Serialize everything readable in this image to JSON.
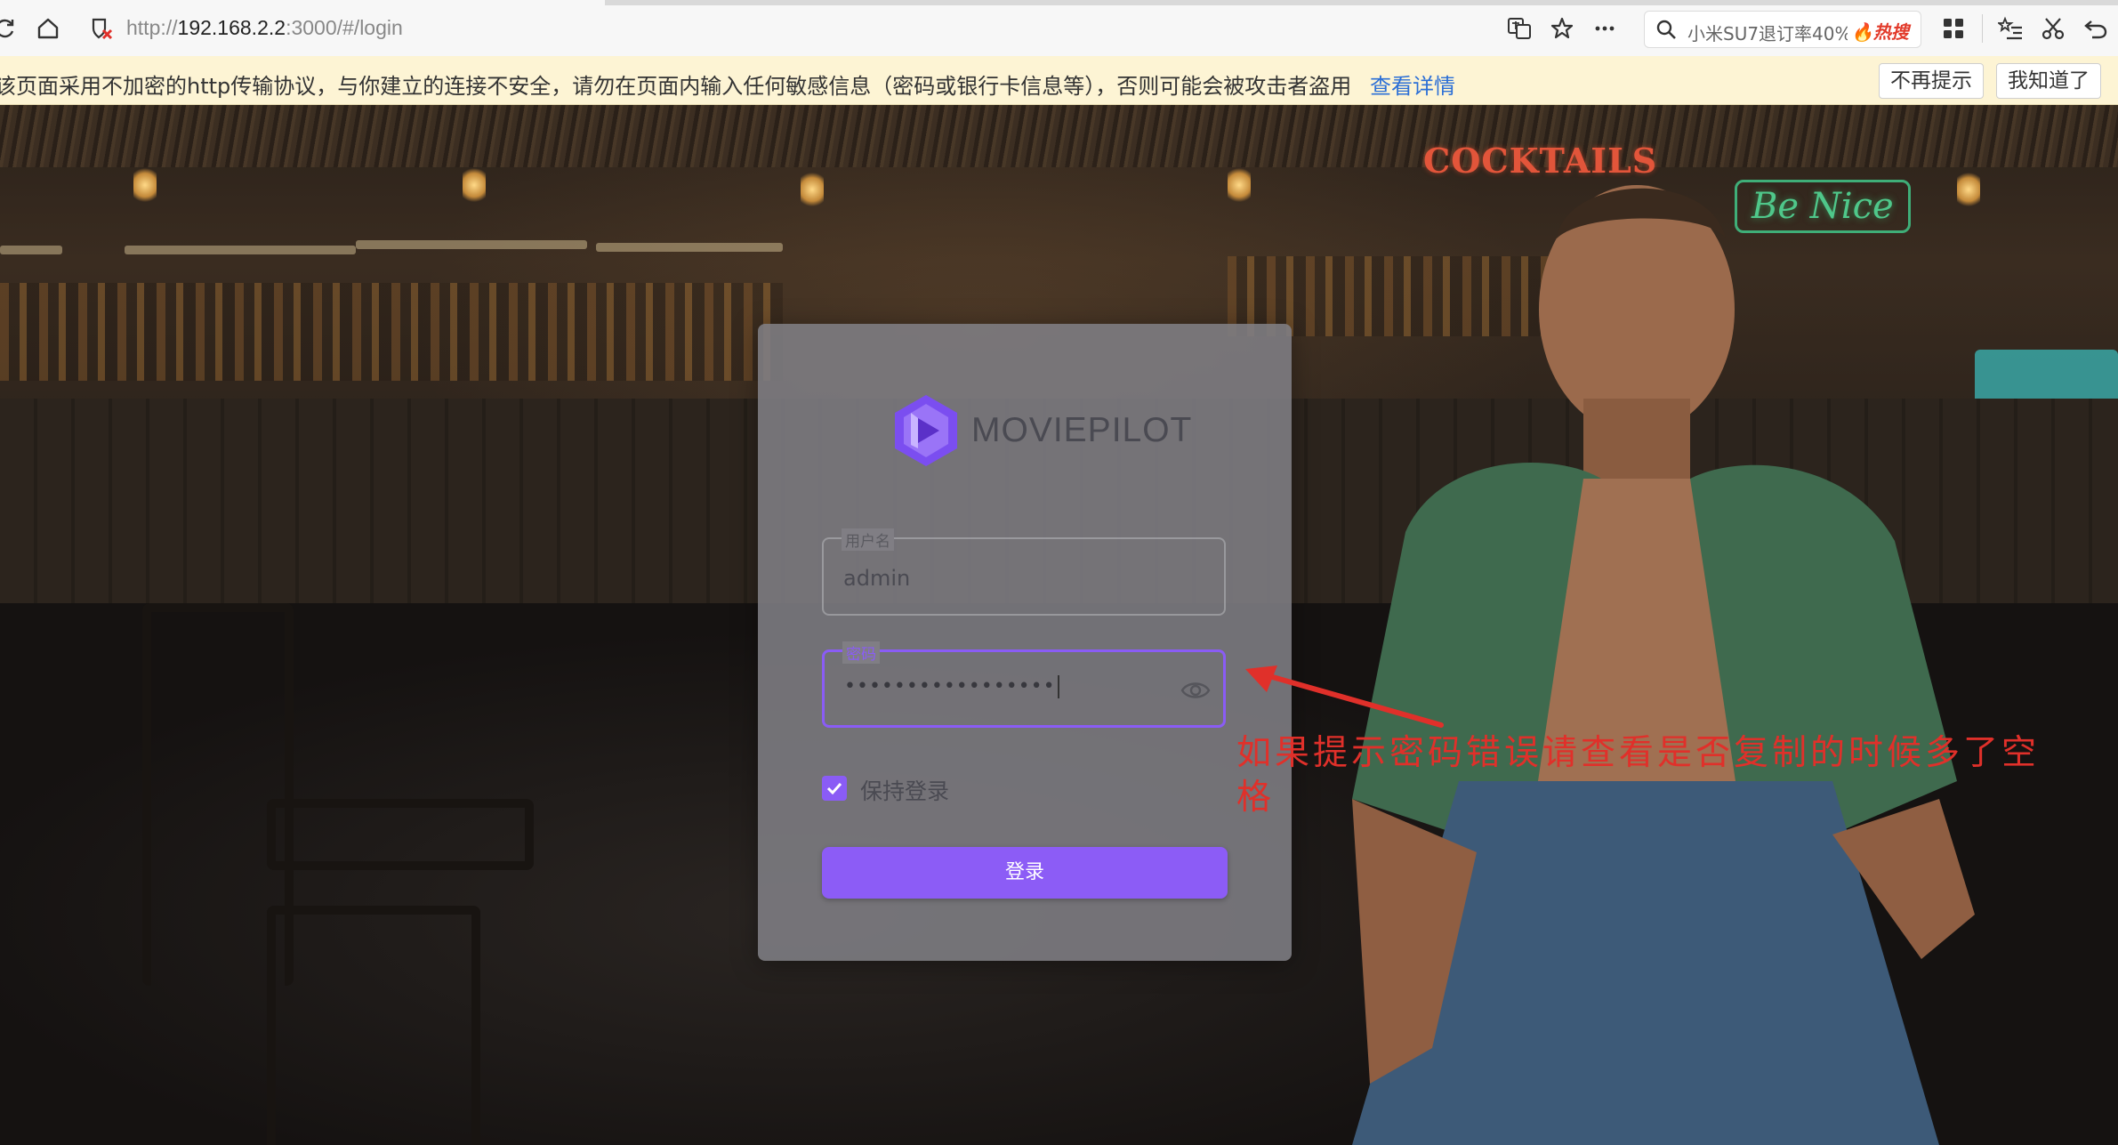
{
  "browser": {
    "url_prefix": "http://",
    "url_host": "192.168.2.2",
    "url_path": ":3000/#/login",
    "search_text": "小米SU7退订率40%",
    "search_badge": "热搜"
  },
  "warning": {
    "message": "该页面采用不加密的http传输协议，与你建立的连接不安全，请勿在页面内输入任何敏感信息（密码或银行卡信息等），否则可能会被攻击者盗用",
    "details_link": "查看详情",
    "dismiss_button": "不再提示",
    "ok_button": "我知道了"
  },
  "scene": {
    "sign_cocktails": "COCKTAILS",
    "sign_benice": "Be Nice"
  },
  "login": {
    "brand": "MOVIEPILOT",
    "username_label": "用户名",
    "username_value": "admin",
    "password_label": "密码",
    "password_mask": "•••••••••••••••••",
    "remember_label": "保持登录",
    "remember_checked": true,
    "submit_label": "登录"
  },
  "annotation": {
    "text": "如果提示密码错误请查看是否复制的时候多了空格",
    "color": "#e0302a"
  },
  "colors": {
    "accent": "#8c5cf6",
    "warn_bg": "#fdf4d4",
    "link": "#2c6fd6"
  }
}
